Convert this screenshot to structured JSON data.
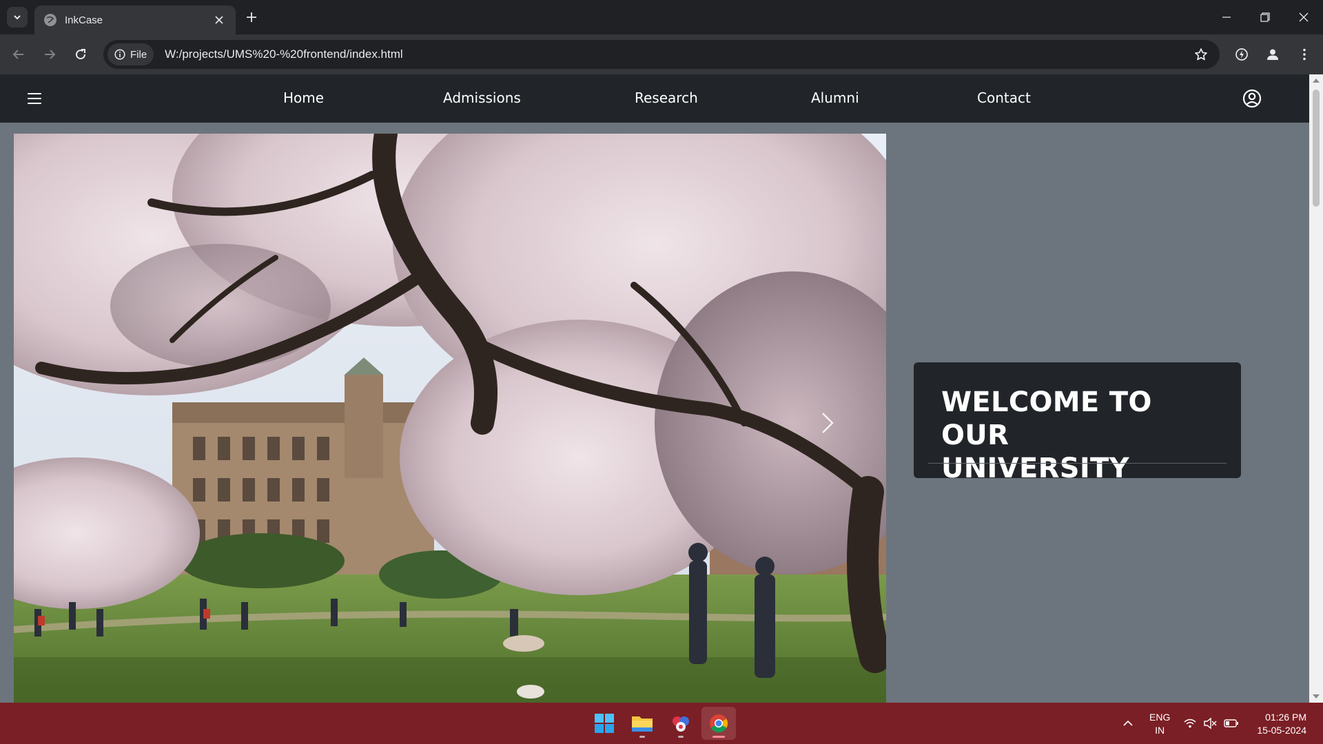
{
  "browser": {
    "tab_title": "InkCase",
    "site_chip_label": "File",
    "url": "W:/projects/UMS%20-%20frontend/index.html"
  },
  "site": {
    "nav_links": [
      "Home",
      "Admissions",
      "Research",
      "Alumni",
      "Contact"
    ],
    "welcome_title_line1": "WELCOME TO OUR",
    "welcome_title_line2": "UNIVERSITY"
  },
  "taskbar": {
    "language_line1": "ENG",
    "language_line2": "IN",
    "time": "01:26 PM",
    "date": "15-05-2024"
  },
  "colors": {
    "navbar": "#212529",
    "page_background": "#6c757d",
    "taskbar": "#7a1f25"
  }
}
